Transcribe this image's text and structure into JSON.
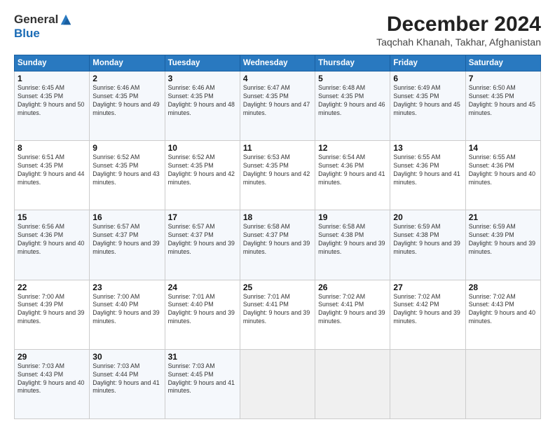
{
  "header": {
    "logo_general": "General",
    "logo_blue": "Blue",
    "month_title": "December 2024",
    "subtitle": "Taqchah Khanah, Takhar, Afghanistan"
  },
  "days_of_week": [
    "Sunday",
    "Monday",
    "Tuesday",
    "Wednesday",
    "Thursday",
    "Friday",
    "Saturday"
  ],
  "weeks": [
    [
      {
        "day": "1",
        "sunrise": "6:45 AM",
        "sunset": "4:35 PM",
        "daylight": "9 hours and 50 minutes."
      },
      {
        "day": "2",
        "sunrise": "6:46 AM",
        "sunset": "4:35 PM",
        "daylight": "9 hours and 49 minutes."
      },
      {
        "day": "3",
        "sunrise": "6:46 AM",
        "sunset": "4:35 PM",
        "daylight": "9 hours and 48 minutes."
      },
      {
        "day": "4",
        "sunrise": "6:47 AM",
        "sunset": "4:35 PM",
        "daylight": "9 hours and 47 minutes."
      },
      {
        "day": "5",
        "sunrise": "6:48 AM",
        "sunset": "4:35 PM",
        "daylight": "9 hours and 46 minutes."
      },
      {
        "day": "6",
        "sunrise": "6:49 AM",
        "sunset": "4:35 PM",
        "daylight": "9 hours and 45 minutes."
      },
      {
        "day": "7",
        "sunrise": "6:50 AM",
        "sunset": "4:35 PM",
        "daylight": "9 hours and 45 minutes."
      }
    ],
    [
      {
        "day": "8",
        "sunrise": "6:51 AM",
        "sunset": "4:35 PM",
        "daylight": "9 hours and 44 minutes."
      },
      {
        "day": "9",
        "sunrise": "6:52 AM",
        "sunset": "4:35 PM",
        "daylight": "9 hours and 43 minutes."
      },
      {
        "day": "10",
        "sunrise": "6:52 AM",
        "sunset": "4:35 PM",
        "daylight": "9 hours and 42 minutes."
      },
      {
        "day": "11",
        "sunrise": "6:53 AM",
        "sunset": "4:35 PM",
        "daylight": "9 hours and 42 minutes."
      },
      {
        "day": "12",
        "sunrise": "6:54 AM",
        "sunset": "4:36 PM",
        "daylight": "9 hours and 41 minutes."
      },
      {
        "day": "13",
        "sunrise": "6:55 AM",
        "sunset": "4:36 PM",
        "daylight": "9 hours and 41 minutes."
      },
      {
        "day": "14",
        "sunrise": "6:55 AM",
        "sunset": "4:36 PM",
        "daylight": "9 hours and 40 minutes."
      }
    ],
    [
      {
        "day": "15",
        "sunrise": "6:56 AM",
        "sunset": "4:36 PM",
        "daylight": "9 hours and 40 minutes."
      },
      {
        "day": "16",
        "sunrise": "6:57 AM",
        "sunset": "4:37 PM",
        "daylight": "9 hours and 39 minutes."
      },
      {
        "day": "17",
        "sunrise": "6:57 AM",
        "sunset": "4:37 PM",
        "daylight": "9 hours and 39 minutes."
      },
      {
        "day": "18",
        "sunrise": "6:58 AM",
        "sunset": "4:37 PM",
        "daylight": "9 hours and 39 minutes."
      },
      {
        "day": "19",
        "sunrise": "6:58 AM",
        "sunset": "4:38 PM",
        "daylight": "9 hours and 39 minutes."
      },
      {
        "day": "20",
        "sunrise": "6:59 AM",
        "sunset": "4:38 PM",
        "daylight": "9 hours and 39 minutes."
      },
      {
        "day": "21",
        "sunrise": "6:59 AM",
        "sunset": "4:39 PM",
        "daylight": "9 hours and 39 minutes."
      }
    ],
    [
      {
        "day": "22",
        "sunrise": "7:00 AM",
        "sunset": "4:39 PM",
        "daylight": "9 hours and 39 minutes."
      },
      {
        "day": "23",
        "sunrise": "7:00 AM",
        "sunset": "4:40 PM",
        "daylight": "9 hours and 39 minutes."
      },
      {
        "day": "24",
        "sunrise": "7:01 AM",
        "sunset": "4:40 PM",
        "daylight": "9 hours and 39 minutes."
      },
      {
        "day": "25",
        "sunrise": "7:01 AM",
        "sunset": "4:41 PM",
        "daylight": "9 hours and 39 minutes."
      },
      {
        "day": "26",
        "sunrise": "7:02 AM",
        "sunset": "4:41 PM",
        "daylight": "9 hours and 39 minutes."
      },
      {
        "day": "27",
        "sunrise": "7:02 AM",
        "sunset": "4:42 PM",
        "daylight": "9 hours and 39 minutes."
      },
      {
        "day": "28",
        "sunrise": "7:02 AM",
        "sunset": "4:43 PM",
        "daylight": "9 hours and 40 minutes."
      }
    ],
    [
      {
        "day": "29",
        "sunrise": "7:03 AM",
        "sunset": "4:43 PM",
        "daylight": "9 hours and 40 minutes."
      },
      {
        "day": "30",
        "sunrise": "7:03 AM",
        "sunset": "4:44 PM",
        "daylight": "9 hours and 41 minutes."
      },
      {
        "day": "31",
        "sunrise": "7:03 AM",
        "sunset": "4:45 PM",
        "daylight": "9 hours and 41 minutes."
      },
      null,
      null,
      null,
      null
    ]
  ],
  "labels": {
    "sunrise": "Sunrise:",
    "sunset": "Sunset:",
    "daylight": "Daylight:"
  }
}
